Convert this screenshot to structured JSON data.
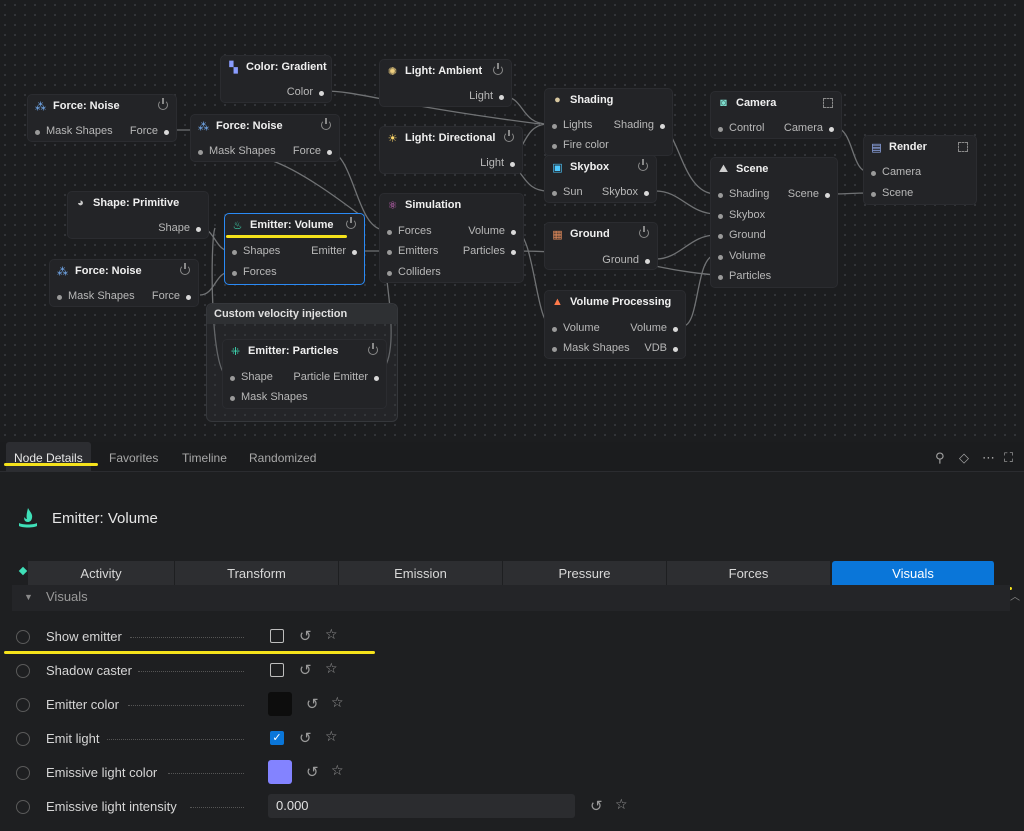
{
  "graph": {
    "nodes": {
      "force_noise_1": {
        "title": "Force: Noise",
        "in": "Mask Shapes",
        "out": "Force"
      },
      "color_gradient": {
        "title": "Color: Gradient",
        "out": "Color"
      },
      "force_noise_2": {
        "title": "Force: Noise",
        "in": "Mask Shapes",
        "out": "Force"
      },
      "light_ambient": {
        "title": "Light: Ambient",
        "out": "Light"
      },
      "light_directional": {
        "title": "Light: Directional",
        "out": "Light"
      },
      "shading": {
        "title": "Shading",
        "in1": "Lights",
        "in2": "Fire color",
        "out": "Shading"
      },
      "skybox": {
        "title": "Skybox",
        "in": "Sun",
        "out": "Skybox"
      },
      "camera": {
        "title": "Camera",
        "in": "Control",
        "out": "Camera"
      },
      "scene": {
        "title": "Scene",
        "in1": "Shading",
        "in2": "Skybox",
        "in3": "Ground",
        "in4": "Volume",
        "in5": "Particles",
        "out": "Scene"
      },
      "render": {
        "title": "Render",
        "in1": "Camera",
        "in2": "Scene"
      },
      "shape_primitive": {
        "title": "Shape: Primitive",
        "out": "Shape"
      },
      "emitter_volume": {
        "title": "Emitter: Volume",
        "in1": "Shapes",
        "in2": "Forces",
        "out": "Emitter"
      },
      "force_noise_3": {
        "title": "Force: Noise",
        "in": "Mask Shapes",
        "out": "Force"
      },
      "simulation": {
        "title": "Simulation",
        "in1": "Forces",
        "in2": "Emitters",
        "in3": "Colliders",
        "out1": "Volume",
        "out2": "Particles"
      },
      "ground": {
        "title": "Ground",
        "out": "Ground"
      },
      "volume_processing": {
        "title": "Volume Processing",
        "in1": "Volume",
        "in2": "Mask Shapes",
        "out1": "Volume",
        "out2": "VDB"
      },
      "emitter_particles": {
        "title": "Emitter: Particles",
        "in1": "Shape",
        "in2": "Mask Shapes",
        "out": "Particle Emitter"
      }
    },
    "group_title": "Custom velocity injection"
  },
  "panel_tabs": [
    "Node Details",
    "Favorites",
    "Timeline",
    "Randomized"
  ],
  "panel_icons": [
    "search-icon",
    "diamond-icon",
    "more-icon",
    "fullscreen-icon"
  ],
  "details": {
    "title": "Emitter: Volume",
    "categories": [
      "Activity",
      "Transform",
      "Emission",
      "Pressure",
      "Forces",
      "Visuals"
    ],
    "active_category": "Visuals",
    "section": "Visuals",
    "properties": [
      {
        "label": "Show emitter",
        "type": "checkbox",
        "checked": false
      },
      {
        "label": "Shadow caster",
        "type": "checkbox",
        "checked": false
      },
      {
        "label": "Emitter color",
        "type": "color",
        "color": "#0d0d0d"
      },
      {
        "label": "Emit light",
        "type": "checkbox",
        "checked": true
      },
      {
        "label": "Emissive light color",
        "type": "color",
        "color": "#8383ff"
      },
      {
        "label": "Emissive light intensity",
        "type": "number",
        "value": "0.000"
      }
    ]
  },
  "colors": {
    "accent": "#0a76d9",
    "highlight": "#f5e21b",
    "selected_border": "#2a8af6"
  }
}
